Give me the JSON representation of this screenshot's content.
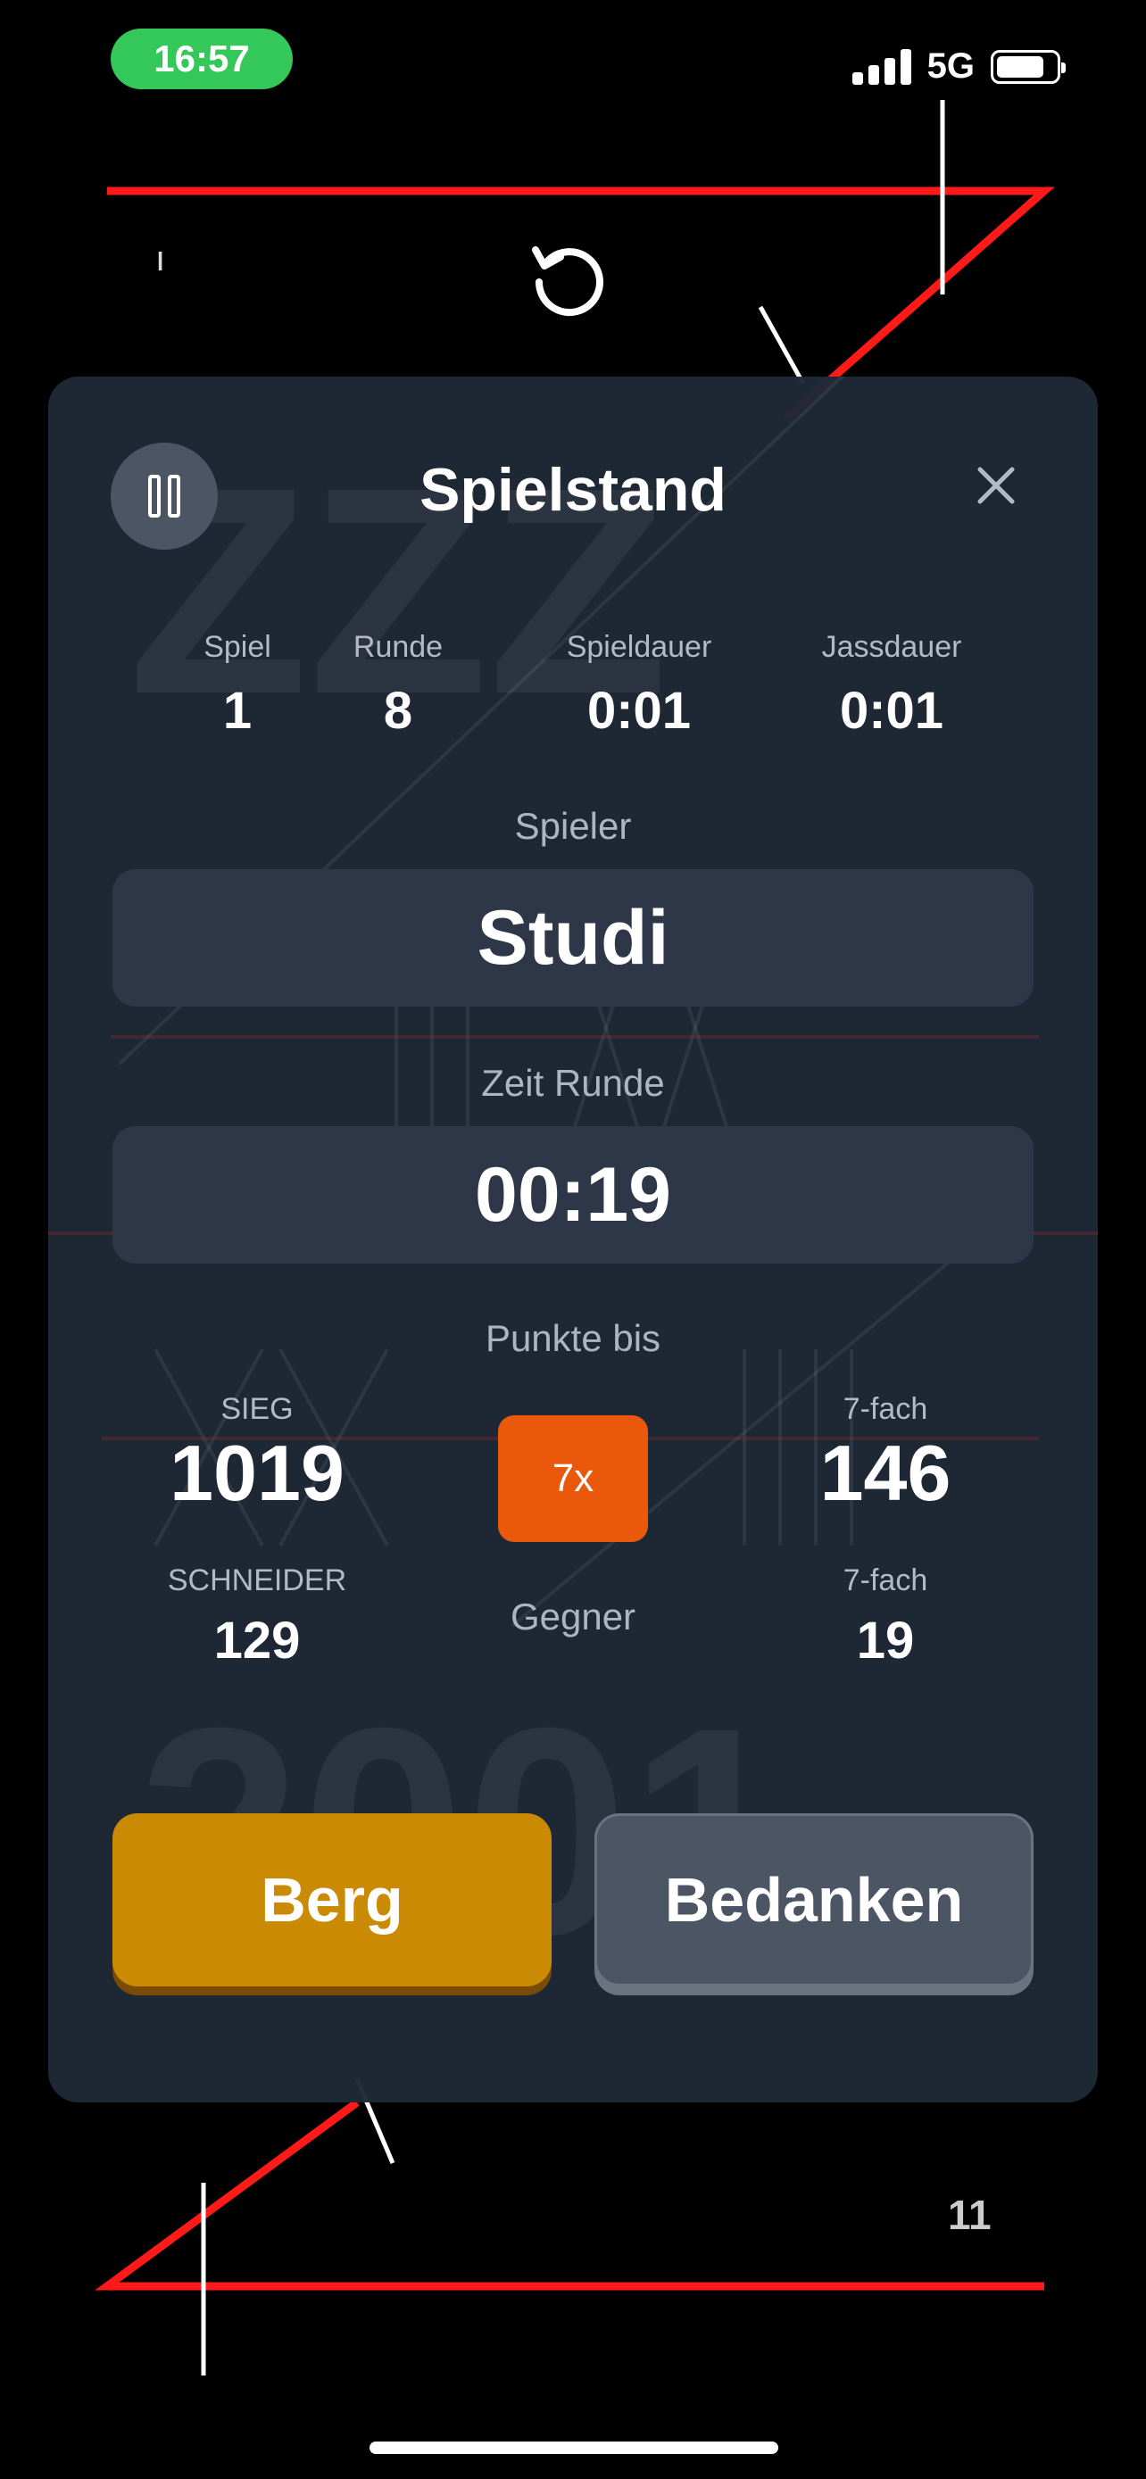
{
  "status_bar": {
    "time": "16:57",
    "network": "5G"
  },
  "board": {
    "small_glyph": "ı",
    "score_bottom_right": "11"
  },
  "modal": {
    "title": "Spielstand",
    "stats": [
      {
        "label": "Spiel",
        "value": "1"
      },
      {
        "label": "Runde",
        "value": "8"
      },
      {
        "label": "Spieldauer",
        "value": "0:01"
      },
      {
        "label": "Jassdauer",
        "value": "0:01"
      }
    ],
    "player_label": "Spieler",
    "player_name": "Studi",
    "round_time_label": "Zeit Runde",
    "round_time": "00:19",
    "points_label": "Punkte bis",
    "sieg_label": "SIEG",
    "sieg_value": "1019",
    "schneider_label": "SCHNEIDER",
    "schneider_value": "129",
    "multiplier_button": "7x",
    "opponent_label": "Gegner",
    "fach_label_top": "7-fach",
    "fach_value_top": "146",
    "fach_label_bottom": "7-fach",
    "fach_value_bottom": "19",
    "berg_button": "Berg",
    "bedanken_button": "Bedanken"
  },
  "colors": {
    "accent_orange": "#ea580c",
    "berg_gold": "#ca8a04",
    "status_green": "#34c759",
    "board_red": "#ff0000"
  }
}
